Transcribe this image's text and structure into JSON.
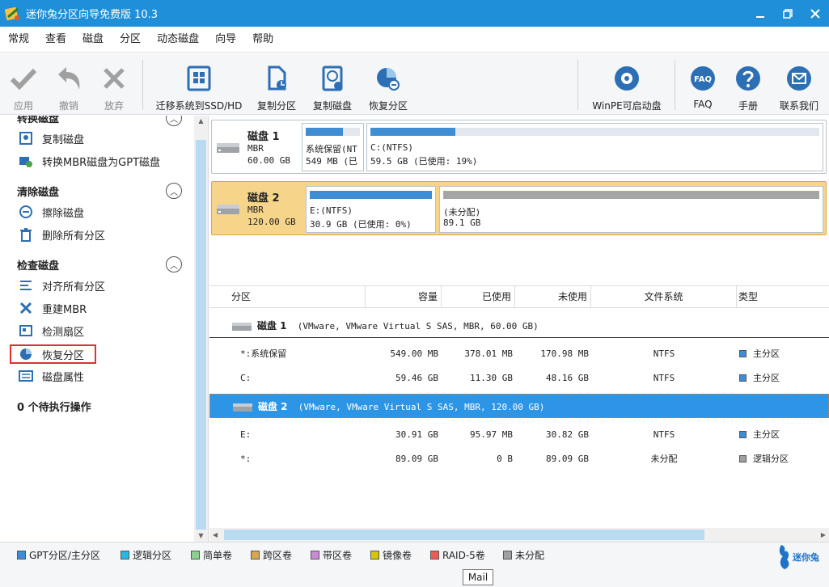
{
  "window": {
    "title": "迷你兔分区向导免费版 10.3"
  },
  "menu": [
    "常规",
    "查看",
    "磁盘",
    "分区",
    "动态磁盘",
    "向导",
    "帮助"
  ],
  "toolbar": {
    "apply": "应用",
    "undo": "撤销",
    "discard": "放弃",
    "migrate": "迁移系统到SSD/HD",
    "copy_partition": "复制分区",
    "copy_disk": "复制磁盘",
    "recover_partition": "恢复分区",
    "winpe": "WinPE可启动盘",
    "faq": "FAQ",
    "manual": "手册",
    "contact": "联系我们",
    "faq_icon_text": "FAQ"
  },
  "sidebar": {
    "section_convert": "转换磁盘",
    "convert_items": [
      "复制磁盘",
      "转换MBR磁盘为GPT磁盘"
    ],
    "section_clean": "清除磁盘",
    "clean_items": [
      "擦除磁盘",
      "删除所有分区"
    ],
    "section_check": "检查磁盘",
    "check_items": [
      "对齐所有分区",
      "重建MBR",
      "检测扇区",
      "恢复分区",
      "磁盘属性"
    ],
    "pending": "0 个待执行操作"
  },
  "disks": [
    {
      "name": "磁盘 1",
      "type": "MBR",
      "size": "60.00 GB",
      "partitions": [
        {
          "label": "系统保留(NT",
          "detail": "549 MB (已",
          "used_fraction": 0.69
        },
        {
          "label": "C:(NTFS)",
          "detail": "59.5 GB (已使用: 19%)",
          "used_fraction": 0.19
        }
      ]
    },
    {
      "name": "磁盘 2",
      "type": "MBR",
      "size": "120.00 GB",
      "partitions": [
        {
          "label": "E:(NTFS)",
          "detail": "30.9 GB (已使用: 0%)",
          "used_fraction": 1.0
        },
        {
          "label": "(未分配)",
          "detail": "89.1 GB",
          "used_fraction": 1.0
        }
      ]
    }
  ],
  "table": {
    "headers": [
      "分区",
      "容量",
      "已使用",
      "未使用",
      "文件系统",
      "类型"
    ],
    "disk1_name": "磁盘 1",
    "disk1_info": "(VMware, VMware Virtual S SAS, MBR, 60.00 GB)",
    "disk2_name": "磁盘 2",
    "disk2_info": "(VMware, VMware Virtual S SAS, MBR, 120.00 GB)",
    "rows": [
      {
        "partition": "*:系统保留",
        "capacity": "549.00 MB",
        "used": "378.01 MB",
        "unused": "170.98 MB",
        "fs": "NTFS",
        "type": "主分区"
      },
      {
        "partition": "C:",
        "capacity": "59.46 GB",
        "used": "11.30 GB",
        "unused": "48.16 GB",
        "fs": "NTFS",
        "type": "主分区"
      },
      {
        "partition": "E:",
        "capacity": "30.91 GB",
        "used": "95.97 MB",
        "unused": "30.82 GB",
        "fs": "NTFS",
        "type": "主分区"
      },
      {
        "partition": "*:",
        "capacity": "89.09 GB",
        "used": "0 B",
        "unused": "89.09 GB",
        "fs": "未分配",
        "type": "逻辑分区"
      }
    ]
  },
  "legend": [
    "GPT分区/主分区",
    "逻辑分区",
    "简单卷",
    "跨区卷",
    "带区卷",
    "镜像卷",
    "RAID-5卷",
    "未分配"
  ],
  "legend_colors": [
    "#3f8dd4",
    "#29b6e0",
    "#8fce8f",
    "#d6a650",
    "#c98ad6",
    "#d6c800",
    "#ee5a5a",
    "#a0a0a0"
  ],
  "brand": "迷你兔",
  "tooltip": "Mail",
  "colors": {
    "titlebar": "#1e8fd8",
    "selection": "#2c95e6",
    "selected_card": "#f6d58a"
  }
}
